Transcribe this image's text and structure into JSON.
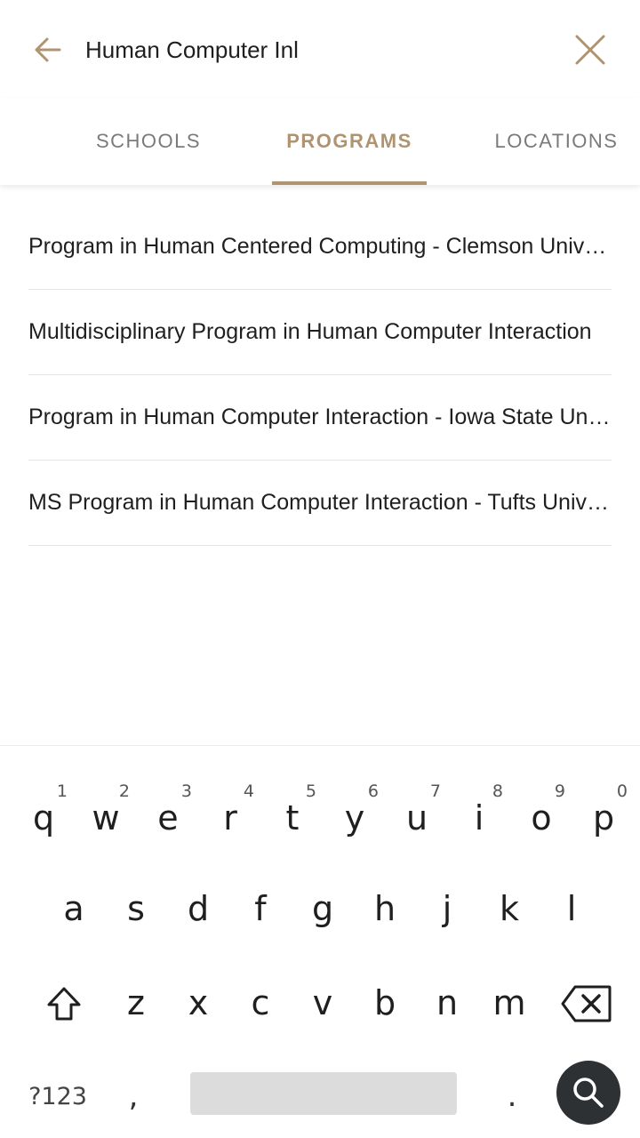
{
  "search": {
    "query": "Human Computer Inl"
  },
  "tabs": [
    {
      "label": "SCHOOLS",
      "active": false
    },
    {
      "label": "PROGRAMS",
      "active": true
    },
    {
      "label": "LOCATIONS",
      "active": false
    }
  ],
  "results": [
    {
      "label": "Program in Human Centered Computing - Clemson University"
    },
    {
      "label": "Multidisciplinary Program in Human Computer Interaction"
    },
    {
      "label": "Program in Human Computer Interaction - Iowa State University"
    },
    {
      "label": "MS Program in Human Computer Interaction - Tufts University"
    }
  ],
  "keyboard": {
    "row1": [
      {
        "key": "q",
        "hint": "1"
      },
      {
        "key": "w",
        "hint": "2"
      },
      {
        "key": "e",
        "hint": "3"
      },
      {
        "key": "r",
        "hint": "4"
      },
      {
        "key": "t",
        "hint": "5"
      },
      {
        "key": "y",
        "hint": "6"
      },
      {
        "key": "u",
        "hint": "7"
      },
      {
        "key": "i",
        "hint": "8"
      },
      {
        "key": "o",
        "hint": "9"
      },
      {
        "key": "p",
        "hint": "0"
      }
    ],
    "row2": [
      "a",
      "s",
      "d",
      "f",
      "g",
      "h",
      "j",
      "k",
      "l"
    ],
    "row3": [
      "z",
      "x",
      "c",
      "v",
      "b",
      "n",
      "m"
    ],
    "symbols_label": "?123",
    "comma_label": ",",
    "period_label": "."
  },
  "colors": {
    "accent": "#b09470",
    "inactive_tab": "#7a7a7a",
    "search_key_bg": "#2e3133"
  },
  "icons": {
    "back": "arrow-left-icon",
    "close": "close-icon",
    "shift": "shift-icon",
    "backspace": "backspace-icon",
    "search": "search-icon"
  }
}
